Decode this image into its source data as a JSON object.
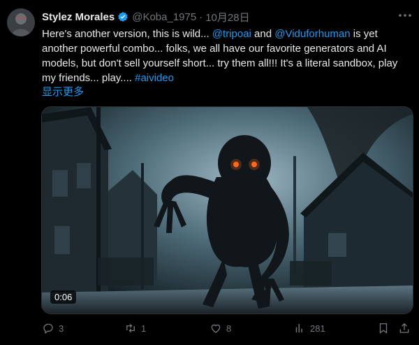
{
  "user": {
    "name": "Stylez Morales",
    "handle": "@Koba_1975",
    "separator": "·",
    "date": "10月28日"
  },
  "post": {
    "text_1": "Here's another version, this is wild... ",
    "mention_1": "@tripoai",
    "text_2": " and ",
    "mention_2": "@Viduforhuman",
    "text_3": " is yet another powerful combo... folks, we all have our favorite generators and AI models, but don't sell yourself short... try them all!!! It's a literal sandbox, play my friends... play.... ",
    "hashtag": "#aivideo",
    "show_more": "显示更多"
  },
  "media": {
    "timecode": "0:06"
  },
  "actions": {
    "replies": "3",
    "reposts": "1",
    "likes": "8",
    "views": "281"
  },
  "colors": {
    "accent": "#1d9bf0",
    "muted": "#71767b",
    "background": "#000000"
  },
  "icons": [
    "verified-badge-icon",
    "more-icon",
    "reply-icon",
    "repost-icon",
    "like-icon",
    "views-icon",
    "bookmark-icon",
    "share-icon"
  ]
}
